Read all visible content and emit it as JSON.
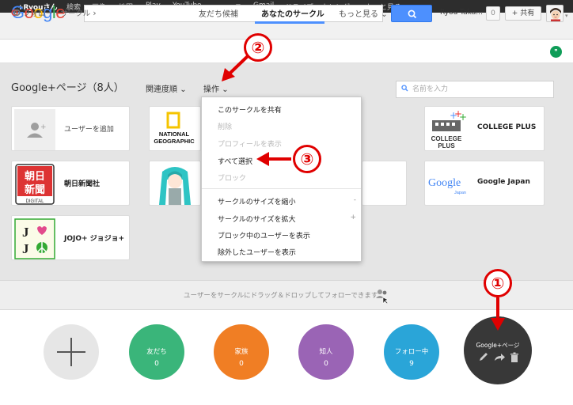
{
  "topbar": {
    "items": [
      "+Ryouさん",
      "検索",
      "画像",
      "地図",
      "Play",
      "YouTube",
      "ニュース",
      "Gmail",
      "ドライブ",
      "カレンダー",
      "もっと見る"
    ]
  },
  "header": {
    "logo_text": "Google",
    "logo_plus": "+",
    "user_name": "Ryou Taka...",
    "notif_count": "0",
    "share_label": "+ 共有"
  },
  "subnav": {
    "follow_label": "フォロー・サークル",
    "tabs": [
      "友だち候補",
      "あなたのサークル",
      "もっと見る"
    ]
  },
  "toolbar": {
    "heading": "Google+ページ（8人）",
    "sort_label": "関連度順",
    "actions_label": "操作"
  },
  "search": {
    "placeholder": "名前を入力"
  },
  "cards": [
    {
      "label": "ユーザーを追加"
    },
    {
      "label": "COLLEGE PLUS"
    },
    {
      "label": "朝日新聞社"
    },
    {
      "label": "Google Japan"
    },
    {
      "label": "JOJO+ ジョジョ+"
    }
  ],
  "logos": {
    "natgeo": [
      "NATIONAL",
      "GEOGRAPHIC"
    ],
    "college": [
      "COLLEGE",
      "PLUS"
    ],
    "asahi": [
      "朝日",
      "新聞",
      "DIGITAL"
    ],
    "google_japan": [
      "Google",
      "Japan"
    ],
    "jojo": [
      "J",
      "J"
    ]
  },
  "menu": {
    "items": [
      {
        "label": "このサークルを共有",
        "disabled": false,
        "key": ""
      },
      {
        "label": "削除",
        "disabled": true,
        "key": ""
      },
      {
        "label": "プロフィールを表示",
        "disabled": true,
        "key": ""
      },
      {
        "label": "すべて選択",
        "disabled": false,
        "key": ""
      },
      {
        "label": "ブロック",
        "disabled": true,
        "key": ""
      },
      {
        "label": "サークルのサイズを縮小",
        "disabled": false,
        "key": "-"
      },
      {
        "label": "サークルのサイズを拡大",
        "disabled": false,
        "key": "+"
      },
      {
        "label": "ブロック中のユーザーを表示",
        "disabled": false,
        "key": ""
      },
      {
        "label": "除外したユーザーを表示",
        "disabled": false,
        "key": ""
      }
    ]
  },
  "drop_hint": "ユーザーをサークルにドラッグ＆ドロップしてフォローできます",
  "circles": [
    {
      "name": "友だち",
      "count": "0",
      "color": "#3ab57a"
    },
    {
      "name": "家族",
      "count": "0",
      "color": "#f07e24"
    },
    {
      "name": "知人",
      "count": "0",
      "color": "#9a64b5"
    },
    {
      "name": "フォロー中",
      "count": "9",
      "color": "#2aa5d8"
    },
    {
      "name": "Google+ページ",
      "count": "",
      "color": "#383838"
    }
  ],
  "annotations": [
    "①",
    "②",
    "③"
  ],
  "colors": {
    "accent": "#4d90fe",
    "annotation": "#e00000"
  }
}
